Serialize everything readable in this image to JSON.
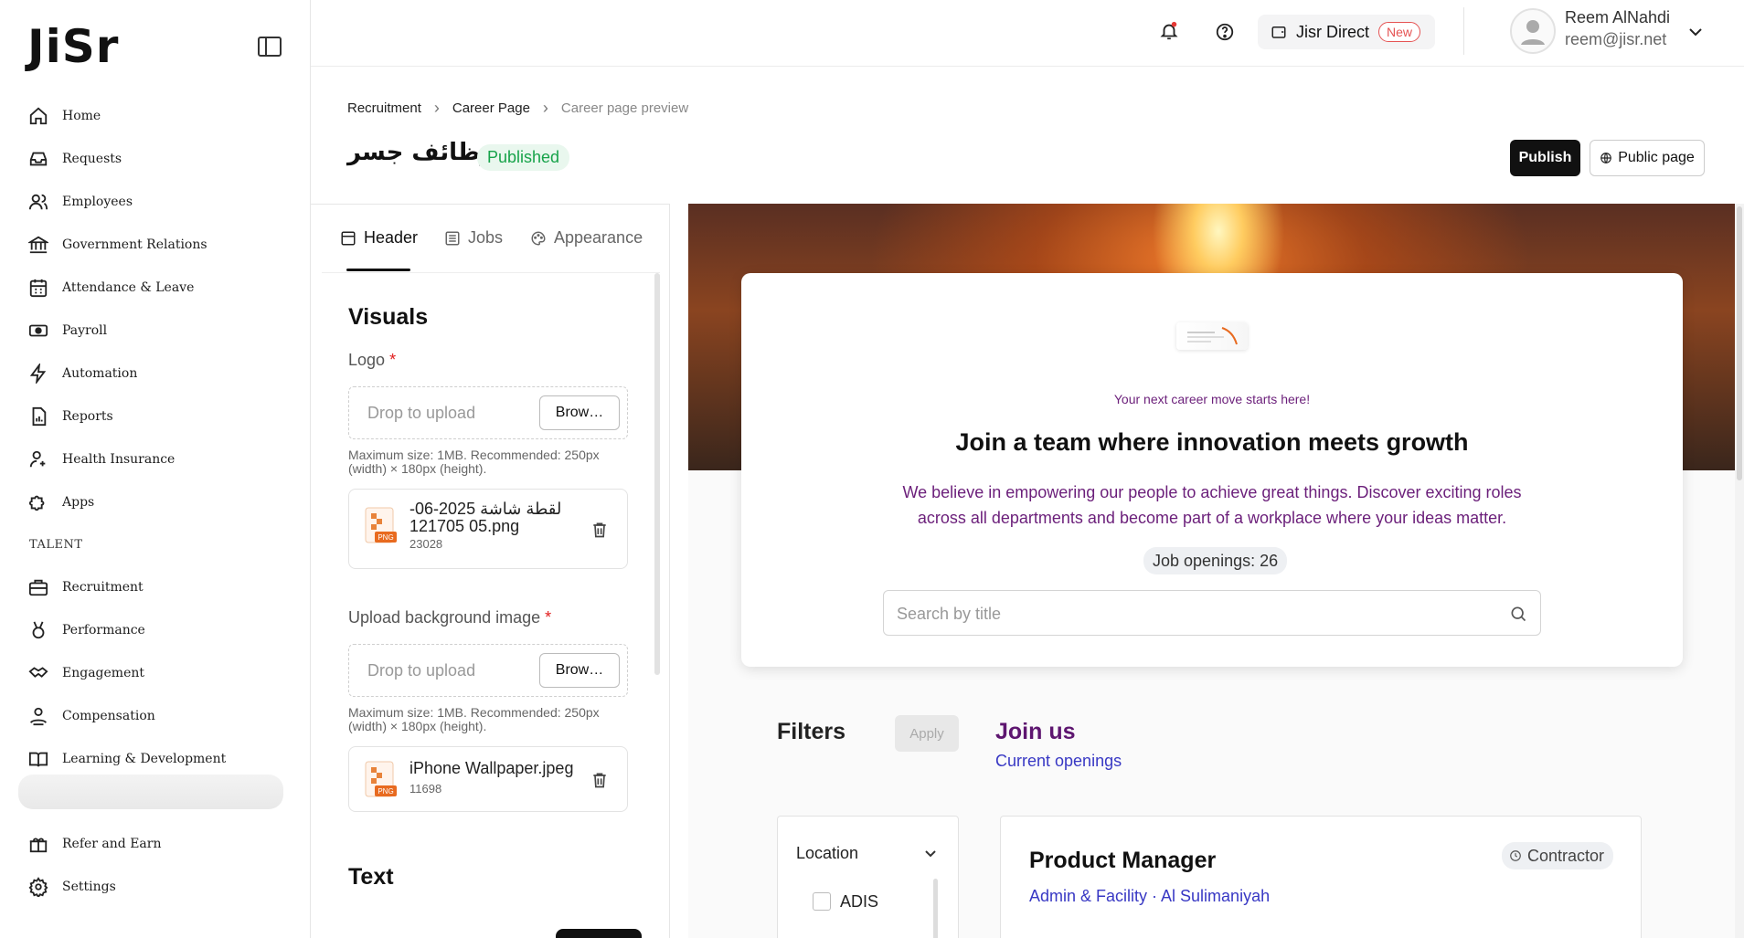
{
  "sidebar": {
    "logo": "JiSr",
    "items": [
      {
        "label": "Home",
        "icon": "home-icon"
      },
      {
        "label": "Requests",
        "icon": "inbox-icon"
      },
      {
        "label": "Employees",
        "icon": "users-icon"
      },
      {
        "label": "Government Relations",
        "icon": "bank-icon"
      },
      {
        "label": "Attendance & Leave",
        "icon": "calendar-icon"
      },
      {
        "label": "Payroll",
        "icon": "money-icon"
      },
      {
        "label": "Automation",
        "icon": "automation-icon"
      },
      {
        "label": "Reports",
        "icon": "report-icon"
      },
      {
        "label": "Health Insurance",
        "icon": "health-icon"
      },
      {
        "label": "Apps",
        "icon": "puzzle-icon"
      }
    ],
    "talent_section": "TALENT",
    "talent_items": [
      {
        "label": "Recruitment",
        "icon": "briefcase-icon"
      },
      {
        "label": "Performance",
        "icon": "medal-icon"
      },
      {
        "label": "Engagement",
        "icon": "handshake-icon"
      },
      {
        "label": "Compensation",
        "icon": "compensation-icon"
      },
      {
        "label": "Learning & Development",
        "icon": "book-icon"
      }
    ],
    "bottom_items": [
      {
        "label": "Refer and Earn",
        "icon": "gift-icon"
      },
      {
        "label": "Settings",
        "icon": "gear-icon"
      }
    ]
  },
  "topbar": {
    "direct_label": "Jisr Direct",
    "new_badge": "New",
    "user_name": "Reem AlNahdi",
    "user_email": "reem@jisr.net"
  },
  "breadcrumb": [
    "Recruitment",
    "Career Page",
    "Career page preview"
  ],
  "page": {
    "title": "وظائف جسر",
    "status": "Published",
    "publish_label": "Publish",
    "public_label": "Public page"
  },
  "editor": {
    "tabs": [
      "Header",
      "Jobs",
      "Appearance"
    ],
    "visuals_title": "Visuals",
    "logo_label": "Logo",
    "drop_text": "Drop to upload",
    "browse_label": "Brow…",
    "hint": "Maximum size: 1MB. Recommended: 250px (width) × 180px (height).",
    "file1_name": "لقطة شاشة 2025-06-05 121705.png",
    "file1_size": "23028",
    "bg_label": "Upload background image",
    "file2_name": "iPhone Wallpaper.jpeg",
    "file2_size": "11698",
    "text_title": "Text",
    "file_badge": "PNG"
  },
  "preview": {
    "tagline": "Your next career move starts here!",
    "title": "Join a team where innovation meets growth",
    "description": "We believe in empowering our people to achieve great things. Discover exciting roles across all departments and become part of a workplace where your ideas matter.",
    "openings": "Job openings: 26",
    "search_placeholder": "Search by title",
    "filters_title": "Filters",
    "apply_label": "Apply",
    "join_title": "Join us",
    "openings_link": "Current openings",
    "filter_location": "Location",
    "filter_option": "ADIS",
    "job": {
      "title": "Product Manager",
      "meta": "Admin & Facility · Al Sulimaniyah",
      "type": "Contractor"
    }
  },
  "colors": {
    "accent_purple": "#6b1f7a",
    "link_blue": "#3838c4",
    "published_green": "#17a34a",
    "new_red": "#e55353"
  }
}
